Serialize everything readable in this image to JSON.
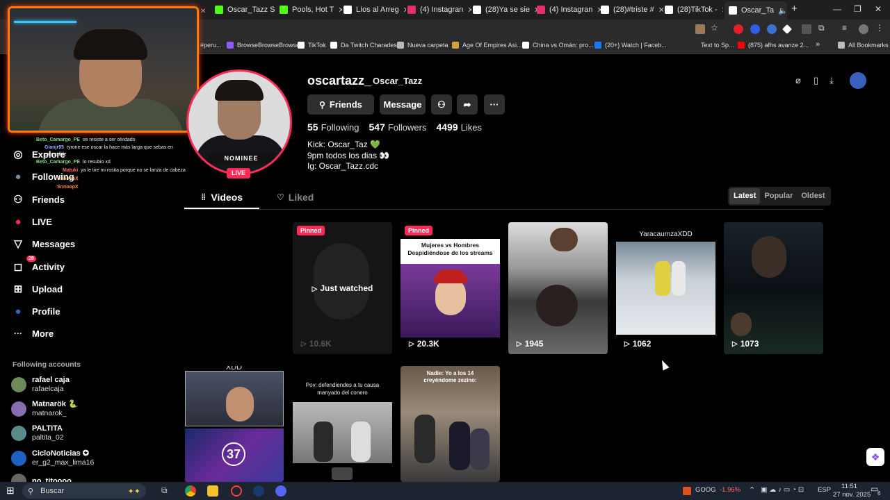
{
  "browser": {
    "tabs": [
      {
        "label": "Oscar_Tazz S",
        "color": "#53fc18"
      },
      {
        "label": "Pools, Hot T",
        "color": "#53fc18"
      },
      {
        "label": "Líos al Arreg",
        "color": "#ffffff"
      },
      {
        "label": "(4) Instagran",
        "color": "#e1306c"
      },
      {
        "label": "(28)Ya se sie",
        "color": "#ffffff"
      },
      {
        "label": "(4) Instagran",
        "color": "#e1306c"
      },
      {
        "label": "(28)#triste #",
        "color": "#ffffff"
      },
      {
        "label": "(28)TikTok -",
        "color": "#ffffff"
      },
      {
        "label": "Oscar_Ta",
        "color": "#ffffff"
      }
    ],
    "new_tab": "+",
    "window_controls": [
      "—",
      "❐",
      "✕"
    ],
    "url_fragment": "#peru...",
    "bookmarks": [
      {
        "label": "BrowseBrowseBrowse",
        "color": "#8c5cff"
      },
      {
        "label": "TikTok",
        "color": "#ffffff"
      },
      {
        "label": "Da Twitch Charades",
        "color": "#ffffff"
      },
      {
        "label": "Nueva carpeta",
        "color": "#bbbbbb"
      },
      {
        "label": "Age Of Empires Asi...",
        "color": "#d0a040"
      },
      {
        "label": "China vs Omán: pro...",
        "color": "#ffffff"
      },
      {
        "label": "(20+) Watch | Faceb...",
        "color": "#1877f2"
      },
      {
        "label": "Text to Sp...",
        "color": "#ffffff"
      },
      {
        "label": "(875) afhs avanze 2...",
        "color": "#ff0000"
      },
      {
        "label": "»",
        "color": "#ffffff"
      },
      {
        "label": "All Bookmarks",
        "color": "#bbbbbb"
      }
    ]
  },
  "chat": [
    {
      "user": "Beto_Camargo_PE",
      "msg": "se resiste a ser olvidado"
    },
    {
      "user": "Gianjr95",
      "msg": "tyrone ese oscar la hace más larga que sebas en extensible"
    },
    {
      "user": "Beto_Camargo_PE",
      "msg": "lo resubio xd"
    },
    {
      "user": "Matuki",
      "msg": "ya le tire mi rosita porque no se lanza de cabeza"
    },
    {
      "user": "SnnoopX",
      "msg": ""
    },
    {
      "user": "SnnoopX",
      "msg": ""
    }
  ],
  "sidebar": {
    "nav": [
      {
        "label": "Explore",
        "icon": "◎"
      },
      {
        "label": "Following",
        "icon": "●"
      },
      {
        "label": "Friends",
        "icon": "⚇"
      },
      {
        "label": "LIVE",
        "icon": "●"
      },
      {
        "label": "Messages",
        "icon": "▽"
      },
      {
        "label": "Activity",
        "icon": "◻"
      },
      {
        "label": "Upload",
        "icon": "⊞"
      },
      {
        "label": "Profile",
        "icon": "●"
      },
      {
        "label": "More",
        "icon": "···"
      }
    ],
    "activity_badge": "28",
    "following_title": "Following accounts",
    "accounts": [
      {
        "name": "rafael caja",
        "handle": "rafaelcaja",
        "color": "#6c8a5a"
      },
      {
        "name": "Matnarök 🐍",
        "handle": "matnarok_",
        "color": "#8a6cb0"
      },
      {
        "name": "PALTITA",
        "handle": "paltita_02",
        "color": "#5a8a8a"
      },
      {
        "name": "CicloNoticias ✪",
        "handle": "er_g2_max_lima16",
        "color": "#2060c0"
      },
      {
        "name": "po_titoooo",
        "handle": "",
        "color": "#666666"
      }
    ]
  },
  "profile": {
    "username": "oscartazz_",
    "nickname": "Oscar_Tazz",
    "avatar_banner": "NOMINEE",
    "live_label": "LIVE",
    "friends_button": "Friends",
    "message_button": "Message",
    "stats": [
      {
        "value": "55",
        "label": "Following"
      },
      {
        "value": "547",
        "label": "Followers"
      },
      {
        "value": "4499",
        "label": "Likes"
      }
    ],
    "bio": [
      "Kick: Oscar_Taz 💚",
      "9pm todos los dias 👀",
      "Ig: Oscar_Tazz.cdc"
    ]
  },
  "tabs": {
    "videos": "Videos",
    "liked": "Liked"
  },
  "sort": [
    "Latest",
    "Popular",
    "Oldest"
  ],
  "videos": [
    {
      "views": "10.6K",
      "pinned": "Pinned",
      "overlay": "Just watched",
      "caption": "",
      "bg": "#1a1a1a"
    },
    {
      "views": "20.3K",
      "pinned": "Pinned",
      "overlay": "",
      "caption": "Mujeres vs Hombres Despidiéndose de los streams",
      "bg": "#6a3a7a"
    },
    {
      "views": "1945",
      "pinned": "",
      "overlay": "",
      "caption": "",
      "bg": "#5a5a5a"
    },
    {
      "views": "1062",
      "pinned": "",
      "overlay": "",
      "caption": "YaracaumzaXDD",
      "bg": "#bfc6cc"
    },
    {
      "views": "1073",
      "pinned": "",
      "overlay": "",
      "caption": "",
      "bg": "#0d1418"
    },
    {
      "views": "",
      "pinned": "",
      "overlay": "",
      "caption": "XDD",
      "bg": "#3a3f50"
    },
    {
      "views": "",
      "pinned": "",
      "overlay": "",
      "caption": "Pov: defendiendes a tu causa manyado del conero",
      "bg": "#5a5a5a"
    },
    {
      "views": "",
      "pinned": "",
      "overlay": "",
      "caption": "Nadie: Yo a los 14 creyéndome zezino:",
      "bg": "#8a7a6a"
    }
  ],
  "taskbar": {
    "search": "Buscar",
    "stock": "GOOG",
    "stock_change": "-1.96%",
    "lang": "ESP",
    "time": "11:51",
    "date": "27 nov. 2025",
    "notif": "6"
  }
}
